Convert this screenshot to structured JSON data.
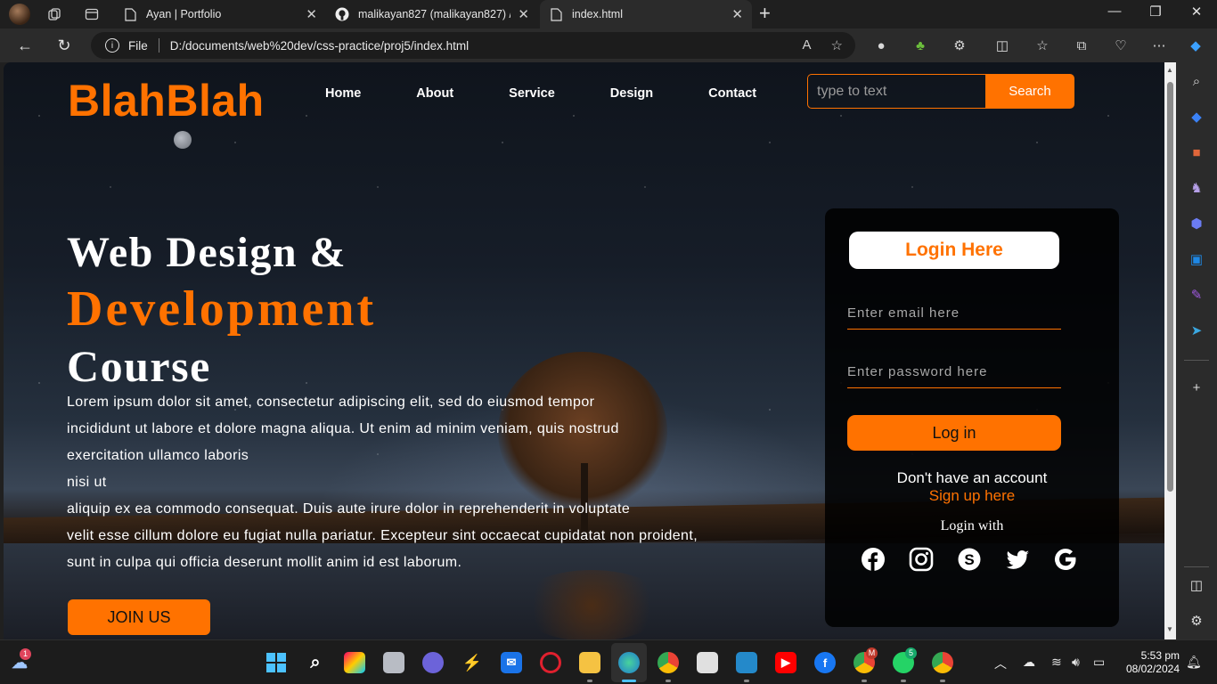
{
  "browser": {
    "tabs": [
      {
        "title": "Ayan | Portfolio",
        "icon": "page-icon"
      },
      {
        "title": "malikayan827 (malikayan827) / R",
        "icon": "github-icon"
      },
      {
        "title": "index.html",
        "icon": "page-icon",
        "active": true
      }
    ],
    "address": {
      "scheme_label": "File",
      "url": "D:/documents/web%20dev/css-practice/proj5/index.html"
    }
  },
  "site": {
    "logo": "BlahBlah",
    "nav": [
      "Home",
      "About",
      "Service",
      "Design",
      "Contact"
    ],
    "search": {
      "placeholder": "type to text",
      "button": "Search"
    },
    "hero": {
      "line1": "Web Design &",
      "line2": "Development",
      "line3": "Course",
      "paragraph_lines": [
        "Lorem ipsum dolor sit amet, consectetur adipiscing elit, sed do eiusmod tempor",
        "incididunt ut labore et dolore magna aliqua. Ut enim ad minim veniam, quis nostrud",
        "exercitation ullamco laboris",
        "nisi ut",
        "aliquip ex ea commodo consequat. Duis aute irure dolor in reprehenderit in voluptate",
        "velit esse cillum dolore eu fugiat nulla pariatur. Excepteur sint occaecat cupidatat non proident,",
        "sunt in culpa qui officia deserunt mollit anim id est laborum."
      ],
      "cta": "JOIN US"
    },
    "login": {
      "title": "Login Here",
      "email_placeholder": "Enter email here",
      "password_placeholder": "Enter password here",
      "button": "Log in",
      "no_account": "Don't have an account",
      "signup": "Sign up here",
      "login_with": "Login with",
      "socials": [
        "facebook-icon",
        "instagram-icon",
        "skype-icon",
        "twitter-icon",
        "google-icon"
      ]
    },
    "colors": {
      "accent": "#ff7200"
    }
  },
  "taskbar": {
    "clock_time": "5:53 pm",
    "clock_date": "08/02/2024",
    "weather_badge": "1",
    "whatsapp_badge": "5",
    "chrome_badge": "M"
  }
}
